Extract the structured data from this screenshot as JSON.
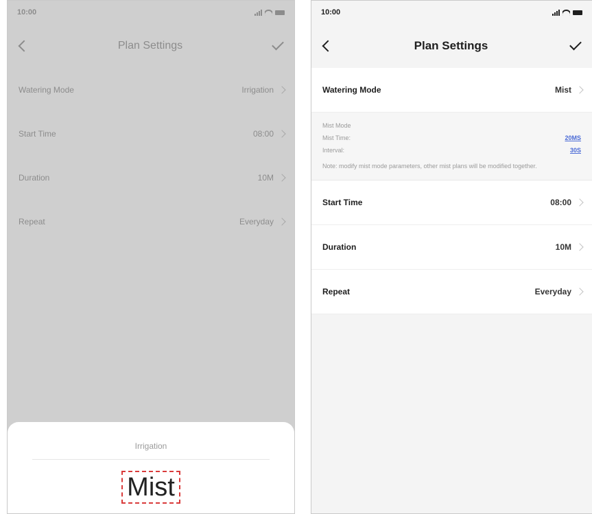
{
  "left": {
    "status": {
      "time": "10:00"
    },
    "nav": {
      "title": "Plan Settings"
    },
    "rows": [
      {
        "label": "Watering Mode",
        "value": "Irrigation"
      },
      {
        "label": "Start Time",
        "value": "08:00"
      },
      {
        "label": "Duration",
        "value": "10M"
      },
      {
        "label": "Repeat",
        "value": "Everyday"
      }
    ],
    "picker": {
      "option": "Irrigation",
      "selected": "Mist"
    }
  },
  "right": {
    "status": {
      "time": "10:00"
    },
    "nav": {
      "title": "Plan Settings"
    },
    "watering_mode": {
      "label": "Watering Mode",
      "value": "Mist"
    },
    "mist": {
      "header": "Mist Mode",
      "mist_time_label": "Mist Time:",
      "mist_time_value": "20MS",
      "interval_label": "Interval:",
      "interval_value": "30S",
      "note": "Note: modify mist mode parameters, other mist plans will be modified together."
    },
    "rows": [
      {
        "label": "Start Time",
        "value": "08:00"
      },
      {
        "label": "Duration",
        "value": "10M"
      },
      {
        "label": "Repeat",
        "value": "Everyday"
      }
    ]
  },
  "colors": {
    "highlight_border": "#d93a3a",
    "link": "#4b6bd6"
  }
}
